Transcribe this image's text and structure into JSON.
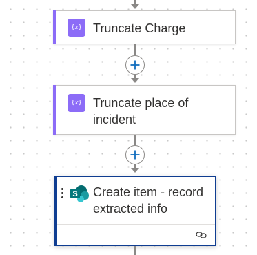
{
  "flow": {
    "steps": [
      {
        "id": "truncate-charge",
        "title": "Truncate Charge",
        "icon": "compose-icon",
        "icon_glyph": "{𝑥}",
        "accent": "#8c6cf7"
      },
      {
        "id": "truncate-place",
        "title": "Truncate place of incident",
        "icon": "compose-icon",
        "icon_glyph": "{𝑥}",
        "accent": "#8c6cf7"
      },
      {
        "id": "create-item",
        "title": "Create item - record extracted info",
        "icon": "sharepoint-icon",
        "accent": "#0f3d91",
        "selected": true,
        "footer_icon": "link-icon"
      }
    ],
    "insert_button_icon": "plus-icon"
  },
  "colors": {
    "compose_accent": "#8c6cf7",
    "selected_border": "#0f3d91",
    "add_plus": "#0f6cbd",
    "connector": "#8a8886"
  }
}
